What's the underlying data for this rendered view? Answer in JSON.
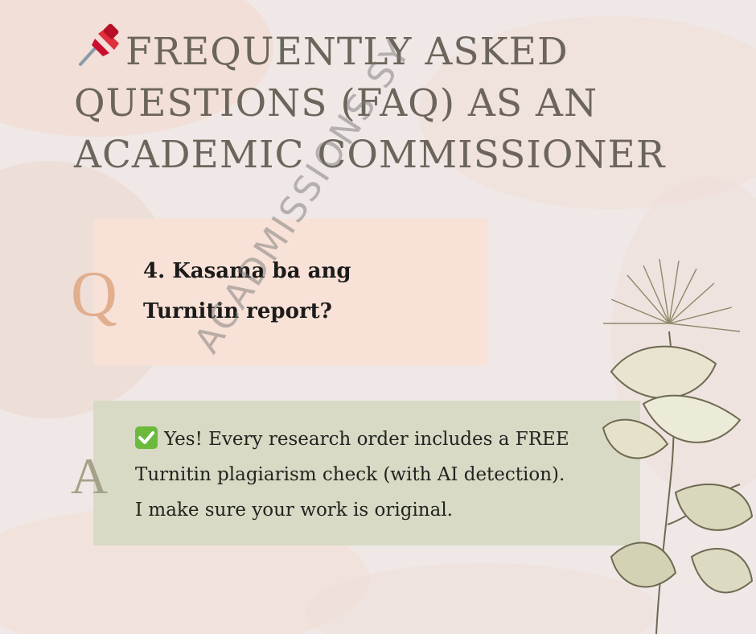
{
  "title": "FREQUENTLY ASKED QUESTIONS (FAQ) AS AN ACADEMIC COMMISSIONER",
  "title_icon": "pushpin-icon",
  "question": {
    "letter": "Q",
    "text_line1": "4. Kasama ba ang",
    "text_line2": "Turnitin report?"
  },
  "answer": {
    "letter": "A",
    "icon": "check-mark-icon",
    "line1": "Yes! Every research order includes a FREE",
    "line2": "Turnitin plagiarism check (with AI detection).",
    "line3": "I make sure your work is original."
  },
  "watermark": "ACADMISSIONS SY",
  "colors": {
    "background": "#efe8e6",
    "question_box": "#f8e1d6",
    "answer_box": "#d8dac5",
    "title_text": "#6b655b",
    "check_green": "#6cba3c"
  }
}
